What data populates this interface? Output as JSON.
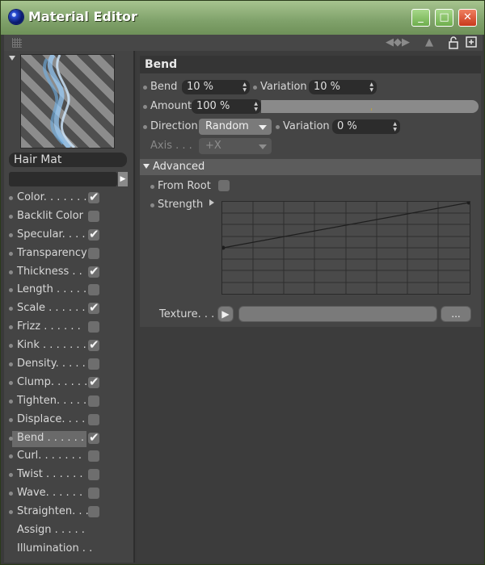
{
  "window": {
    "title": "Material Editor",
    "buttons": {
      "minimize": "_",
      "maximize": "□",
      "close": "✕"
    }
  },
  "toolbar": {
    "icons": [
      "grip-icon",
      "back-forward-arrows-icon",
      "up-arrow-icon",
      "lock-icon",
      "new-window-icon"
    ]
  },
  "left_panel": {
    "material_name": "Hair Mat",
    "channels": [
      {
        "label": "Color. . . . . . .",
        "checked": true
      },
      {
        "label": "Backlit Color",
        "checked": false
      },
      {
        "label": "Specular. . . .",
        "checked": true
      },
      {
        "label": "Transparency",
        "checked": false
      },
      {
        "label": "Thickness . .",
        "checked": true
      },
      {
        "label": "Length . . . . .",
        "checked": false
      },
      {
        "label": "Scale . . . . . .",
        "checked": true
      },
      {
        "label": "Frizz . . . . . .",
        "checked": false
      },
      {
        "label": "Kink . . . . . . .",
        "checked": true
      },
      {
        "label": "Density. . . . .",
        "checked": false
      },
      {
        "label": "Clump. . . . . .",
        "checked": true
      },
      {
        "label": "Tighten. . . . .",
        "checked": false
      },
      {
        "label": "Displace. . . .",
        "checked": false
      },
      {
        "label": "Bend . . . . . .",
        "checked": true,
        "active": true
      },
      {
        "label": "Curl. . . . . . .",
        "checked": false
      },
      {
        "label": "Twist . . . . . .",
        "checked": false
      },
      {
        "label": "Wave. . . . . .",
        "checked": false
      },
      {
        "label": "Straighten. . .",
        "checked": false
      },
      {
        "label": "Assign . . . . .",
        "checkbox": false
      },
      {
        "label": "Illumination . .",
        "checkbox": false
      }
    ]
  },
  "bend": {
    "section_title": "Bend",
    "bend_label": "Bend",
    "bend_value": "10 %",
    "variation_label": "Variation",
    "variation_value": "10 %",
    "amount_label": "Amount",
    "amount_value": "100 %",
    "amount_fraction": 0.96,
    "direction_label": "Direction",
    "direction_value": "Random",
    "direction_variation_label": "Variation",
    "direction_variation_value": "0 %",
    "axis_label": "Axis . . .",
    "axis_value": "+X",
    "advanced_label": "Advanced",
    "from_root_label": "From Root",
    "strength_label": "Strength",
    "strength_curve": [
      {
        "x": 0,
        "y": 0.5
      },
      {
        "x": 1,
        "y": 1
      }
    ],
    "texture_label": "Texture. . .",
    "texture_more_label": "..."
  }
}
